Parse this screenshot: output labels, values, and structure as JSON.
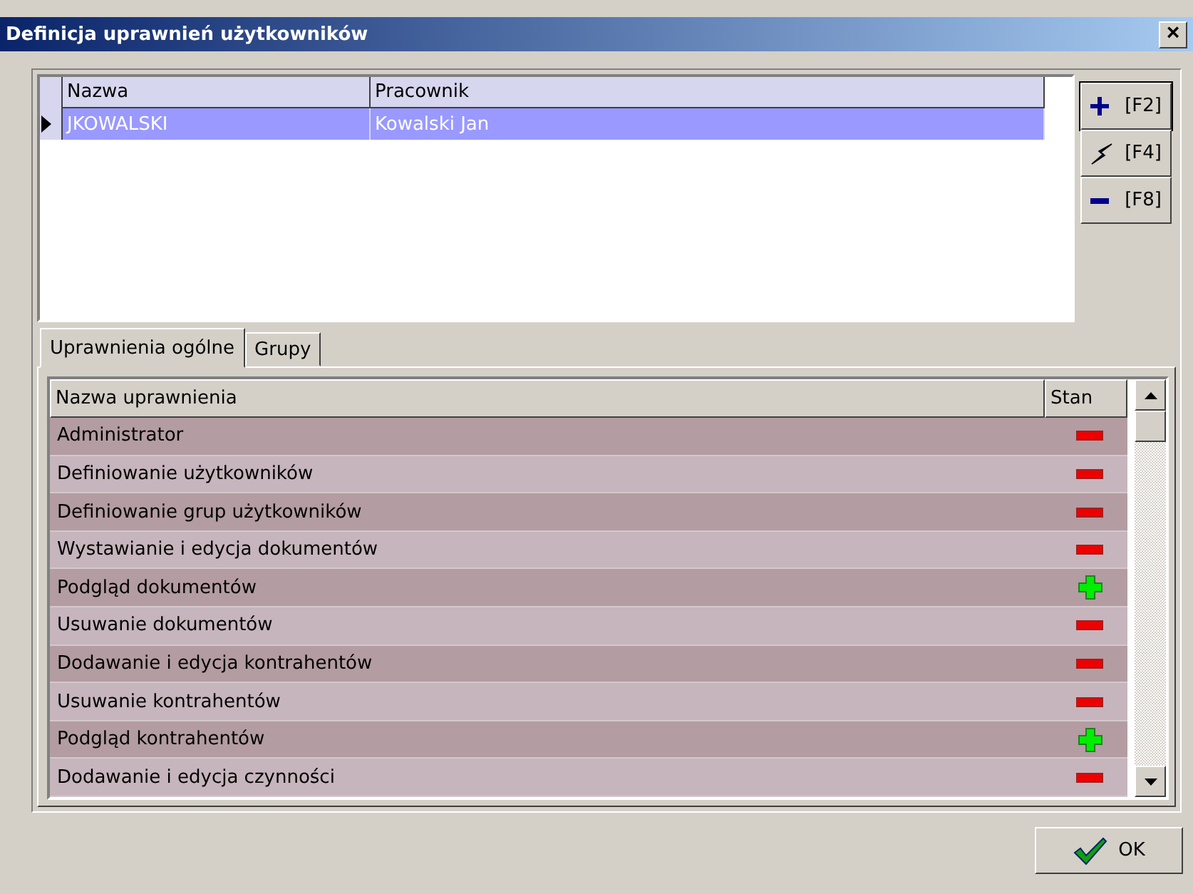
{
  "window": {
    "title": "Definicja uprawnień użytkowników",
    "close_label": "×"
  },
  "users": {
    "columns": [
      "Nazwa",
      "Pracownik"
    ],
    "rows": [
      {
        "name": "JKOWALSKI",
        "employee": "Kowalski Jan",
        "selected": true
      }
    ]
  },
  "actions": [
    {
      "kind": "add",
      "label": "[F2]"
    },
    {
      "kind": "edit",
      "label": "[F4]"
    },
    {
      "kind": "remove",
      "label": "[F8]"
    }
  ],
  "tabs": [
    {
      "label": "Uprawnienia ogólne",
      "selected": true
    },
    {
      "label": "Grupy",
      "selected": false
    }
  ],
  "permissions": {
    "columns": [
      "Nazwa uprawnienia",
      "Stan"
    ],
    "rows": [
      {
        "name": "Administrator",
        "granted": false
      },
      {
        "name": "Definiowanie użytkowników",
        "granted": false
      },
      {
        "name": "Definiowanie grup użytkowników",
        "granted": false
      },
      {
        "name": "Wystawianie i edycja dokumentów",
        "granted": false
      },
      {
        "name": "Podgląd dokumentów",
        "granted": true
      },
      {
        "name": "Usuwanie dokumentów",
        "granted": false
      },
      {
        "name": "Dodawanie i edycja kontrahentów",
        "granted": false
      },
      {
        "name": "Usuwanie kontrahentów",
        "granted": false
      },
      {
        "name": "Podgląd kontrahentów",
        "granted": true
      },
      {
        "name": "Dodawanie i edycja czynności",
        "granted": false
      }
    ]
  },
  "ok_button": "OK"
}
